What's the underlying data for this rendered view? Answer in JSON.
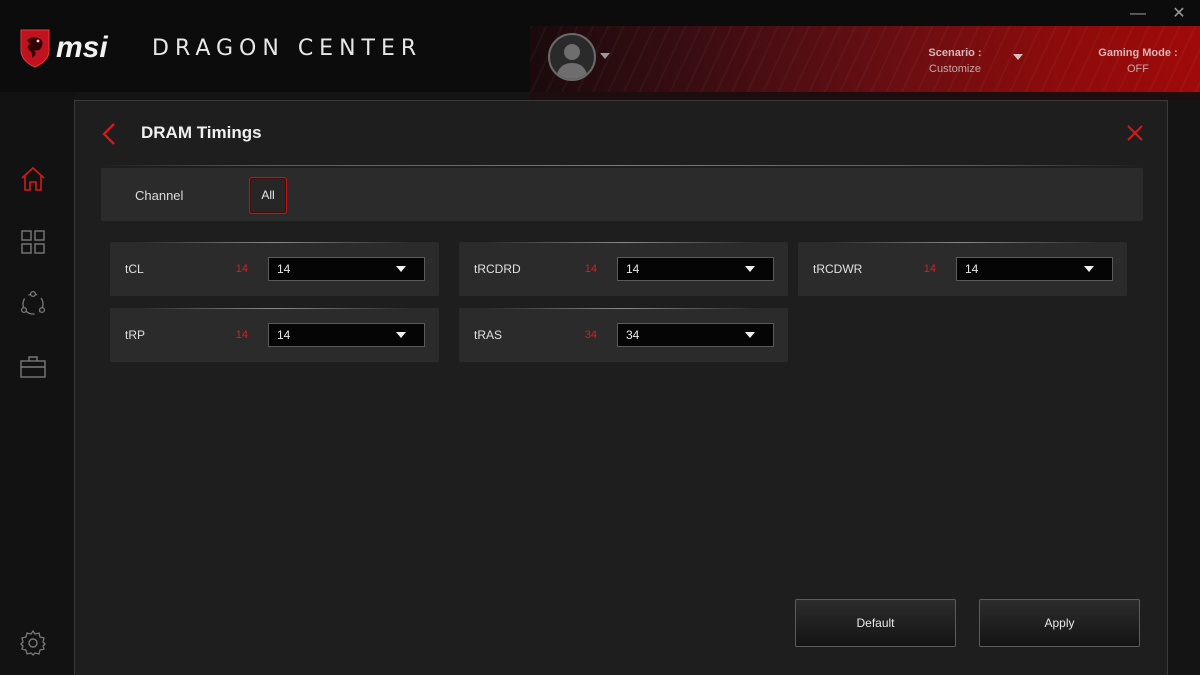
{
  "header": {
    "brand": "msi",
    "app_name": "DRAGON CENTER",
    "scenario": {
      "label": "Scenario :",
      "value": "Customize"
    },
    "gaming_mode": {
      "label": "Gaming Mode :",
      "value": "OFF"
    },
    "minimize_glyph": "—",
    "close_glyph": "✕"
  },
  "sidebar": {
    "items": [
      {
        "icon": "home-icon",
        "active": true
      },
      {
        "icon": "apps-grid-icon",
        "active": false
      },
      {
        "icon": "network-icon",
        "active": false
      },
      {
        "icon": "toolbox-icon",
        "active": false
      }
    ],
    "bottom_icon": "gear-icon"
  },
  "panel": {
    "title": "DRAM Timings",
    "channel": {
      "label": "Channel",
      "selected": "All"
    },
    "timings": [
      {
        "name": "tCL",
        "current": "14",
        "selected": "14"
      },
      {
        "name": "tRCDRD",
        "current": "14",
        "selected": "14"
      },
      {
        "name": "tRCDWR",
        "current": "14",
        "selected": "14"
      },
      {
        "name": "tRP",
        "current": "14",
        "selected": "14"
      },
      {
        "name": "tRAS",
        "current": "34",
        "selected": "34"
      }
    ],
    "buttons": {
      "default": "Default",
      "apply": "Apply"
    }
  },
  "colors": {
    "accent": "#e01b1b",
    "panel_bg": "#1e1e1e",
    "card_bg": "#2b2b2b"
  }
}
